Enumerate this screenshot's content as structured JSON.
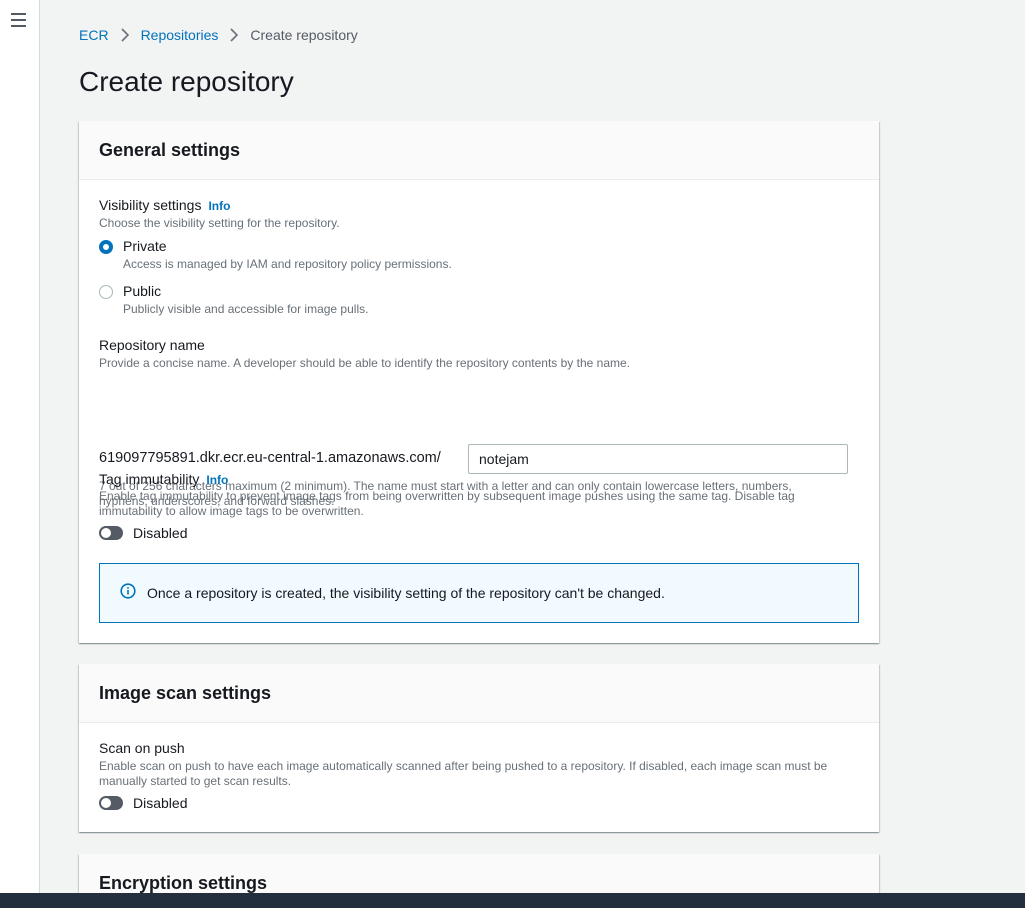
{
  "breadcrumb": {
    "items": [
      "ECR",
      "Repositories"
    ],
    "current": "Create repository"
  },
  "page_title": "Create repository",
  "general": {
    "header": "General settings",
    "visibility_label": "Visibility settings",
    "info_label": "Info",
    "visibility_desc": "Choose the visibility setting for the repository.",
    "private_label": "Private",
    "private_desc": "Access is managed by IAM and repository policy permissions.",
    "public_label": "Public",
    "public_desc": "Publicly visible and accessible for image pulls.",
    "repo_name_label": "Repository name",
    "repo_name_desc": "Provide a concise name. A developer should be able to identify the repository contents by the name.",
    "repo_prefix": "619097795891.dkr.ecr.eu-central-1.amazonaws.com/",
    "repo_name_value": "notejam",
    "repo_name_hint_1": "7 out of 256 characters maximum (2 minimum). The name must start with a letter and can only contain lowercase letters, numbers,",
    "repo_name_hint_2": "hyphens, underscores, and forward slashes.",
    "tag_label": "Tag immutability",
    "tag_desc_1": "Enable tag immutability to prevent image tags from being overwritten by subsequent image pushes using the same tag. Disable tag",
    "tag_desc_2": "immutability to allow image tags to be overwritten.",
    "tag_toggle_label": "Disabled",
    "alert_text": "Once a repository is created, the visibility setting of the repository can't be changed."
  },
  "scan": {
    "header": "Image scan settings",
    "label": "Scan on push",
    "desc_1": "Enable scan on push to have each image automatically scanned after being pushed to a repository. If disabled, each image scan must be",
    "desc_2": "manually started to get scan results.",
    "toggle_label": "Disabled"
  },
  "encryption": {
    "header": "Encryption settings"
  },
  "colors": {
    "link": "#0073bb",
    "alert_border": "#0073bb",
    "alert_bg": "#f1faff",
    "toggle_off": "#545b64",
    "footer": "#232f3e"
  }
}
